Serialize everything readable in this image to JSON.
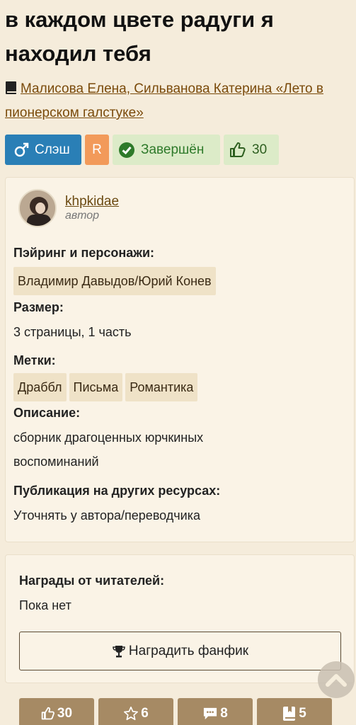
{
  "work": {
    "title": "в каждом цвете радуги я находил тебя",
    "fandom": "Малисова Елена, Сильванова Катерина «Лето в пионерском галстуке»"
  },
  "badges": {
    "direction": "Слэш",
    "rating": "R",
    "status": "Завершён",
    "likes": "30"
  },
  "author": {
    "name": "khpkidae",
    "role": "автор"
  },
  "fields": {
    "pairing_label": "Пэйринг и персонажи:",
    "pairing_value": "Владимир Давыдов/Юрий Конев",
    "size_label": "Размер:",
    "size_value": "3 страницы, 1 часть",
    "tags_label": "Метки:",
    "tags": [
      "Драббл",
      "Письма",
      "Романтика"
    ],
    "description_label": "Описание:",
    "description_value": "сборник драгоценных юрчкиных воспоминаний",
    "publication_label": "Публикация на других ресурсах:",
    "publication_value": "Уточнять у автора/переводчика"
  },
  "awards": {
    "label": "Награды от читателей:",
    "value": "Пока нет",
    "button_label": "Наградить фанфик"
  },
  "bottom_bar": {
    "likes": "30",
    "favorites": "6",
    "comments": "8",
    "collections": "5"
  },
  "colors": {
    "background": "#f5ecdb",
    "slash_badge": "#2a7fb6",
    "rating_badge": "#f29a5a",
    "status_badge": "#dcebc8",
    "bottom_buttons": "#a68a64",
    "link": "#7a4a0a"
  }
}
